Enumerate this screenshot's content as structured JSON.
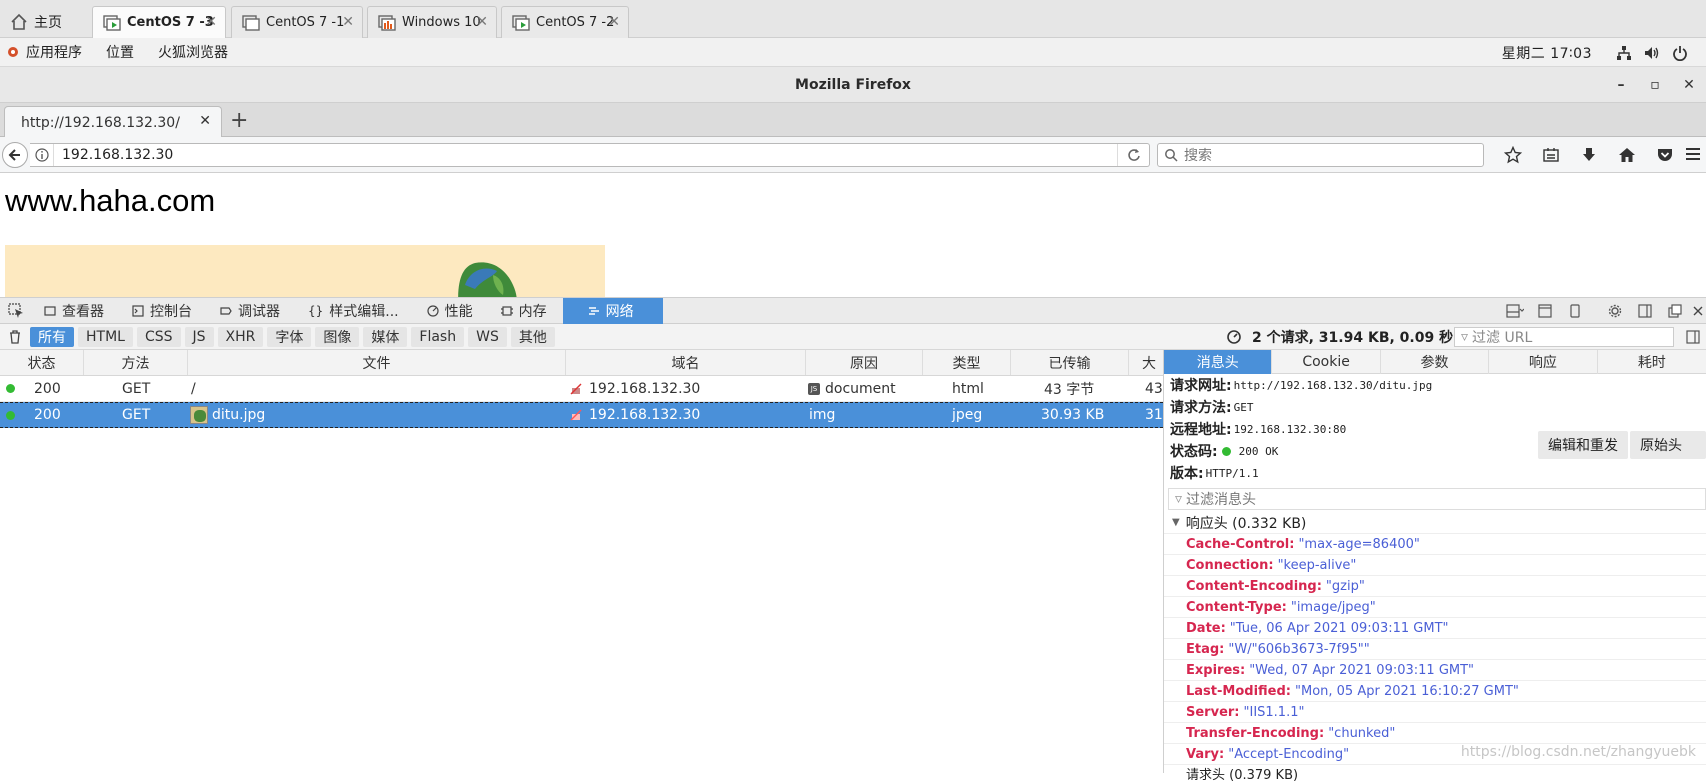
{
  "vm_tabs": [
    {
      "label": "主页",
      "close": ""
    },
    {
      "label": "CentOS 7  -3",
      "close": "✕",
      "active": true
    },
    {
      "label": "CentOS 7 -1",
      "close": "✕"
    },
    {
      "label": "Windows 10",
      "close": "✕"
    },
    {
      "label": "CentOS 7 -2",
      "close": "✕"
    }
  ],
  "gnome_panel": {
    "menus": [
      "应用程序",
      "位置",
      "火狐浏览器"
    ],
    "clock": "星期二 17∶03"
  },
  "firefox": {
    "window_title": "Mozilla Firefox",
    "win_controls": {
      "minimize": "–",
      "maximize": "▫",
      "close": "✕"
    },
    "tab": {
      "label": "http://192.168.132.30/",
      "close": "✕"
    },
    "new_tab": "+",
    "url": "192.168.132.30",
    "search_placeholder": "搜索"
  },
  "page": {
    "heading": "www.haha.com"
  },
  "devtools": {
    "tabs": [
      {
        "label": "查看器",
        "icon": "inspector-icon"
      },
      {
        "label": "控制台",
        "icon": "console-icon"
      },
      {
        "label": "调试器",
        "icon": "debugger-icon"
      },
      {
        "label": "样式编辑...",
        "icon": "style-editor-icon"
      },
      {
        "label": "性能",
        "icon": "performance-icon"
      },
      {
        "label": "内存",
        "icon": "memory-icon"
      },
      {
        "label": "网络",
        "icon": "network-icon",
        "active": true
      }
    ],
    "filters": [
      "所有",
      "HTML",
      "CSS",
      "JS",
      "XHR",
      "字体",
      "图像",
      "媒体",
      "Flash",
      "WS",
      "其他"
    ],
    "summary": "2 个请求, 31.94 KB, 0.09 秒",
    "url_filter_placeholder": "过滤 URL",
    "columns": [
      "状态",
      "方法",
      "文件",
      "域名",
      "原因",
      "类型",
      "已传输",
      "大"
    ],
    "rows": [
      {
        "status": "200",
        "method": "GET",
        "file": "/",
        "domain": "192.168.132.30",
        "cause": "document",
        "type": "html",
        "transferred": "43 字节",
        "size": "43"
      },
      {
        "status": "200",
        "method": "GET",
        "file": "ditu.jpg",
        "domain": "192.168.132.30",
        "cause": "img",
        "type": "jpeg",
        "transferred": "30.93 KB",
        "size": "31",
        "selected": true
      }
    ],
    "details": {
      "tabs": [
        "消息头",
        "Cookie",
        "参数",
        "响应",
        "耗时"
      ],
      "request_url_label": "请求网址:",
      "request_url": "http://192.168.132.30/ditu.jpg",
      "request_method_label": "请求方法:",
      "request_method": "GET",
      "remote_address_label": "远程地址:",
      "remote_address": "192.168.132.30:80",
      "status_label": "状态码:",
      "status": "200 OK",
      "version_label": "版本:",
      "version": "HTTP/1.1",
      "edit_resend": "编辑和重发",
      "raw_headers": "原始头",
      "filter_headers_placeholder": "过滤消息头",
      "response_headers_title": "响应头 (0.332 KB)",
      "response_headers": [
        {
          "name": "Cache-Control:",
          "value": "\"max-age=86400\""
        },
        {
          "name": "Connection:",
          "value": "\"keep-alive\""
        },
        {
          "name": "Content-Encoding:",
          "value": "\"gzip\""
        },
        {
          "name": "Content-Type:",
          "value": "\"image/jpeg\""
        },
        {
          "name": "Date:",
          "value": "\"Tue, 06 Apr 2021 09:03:11 GMT\""
        },
        {
          "name": "Etag:",
          "value": "\"W/\"606b3673-7f95\"\""
        },
        {
          "name": "Expires:",
          "value": "\"Wed, 07 Apr 2021 09:03:11 GMT\""
        },
        {
          "name": "Last-Modified:",
          "value": "\"Mon, 05 Apr 2021 16:10:27 GMT\""
        },
        {
          "name": "Server:",
          "value": "\"IIS1.1.1\""
        },
        {
          "name": "Transfer-Encoding:",
          "value": "\"chunked\""
        },
        {
          "name": "Vary:",
          "value": "\"Accept-Encoding\""
        }
      ],
      "request_headers_partial": "请求头 (0.379 KB)"
    }
  },
  "watermark": "https://blog.csdn.net/zhangyuebk",
  "colors": {
    "accent": "#4a90d9",
    "header_name": "#d6264f",
    "header_value": "#4a5fd6",
    "status_ok": "#33bb33"
  }
}
